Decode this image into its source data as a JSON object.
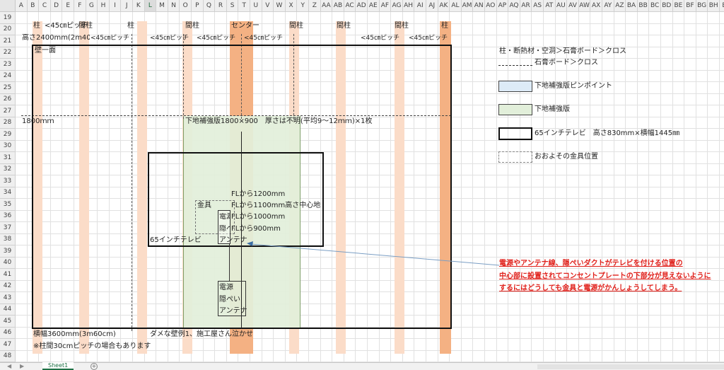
{
  "columns": [
    "A",
    "B",
    "C",
    "D",
    "E",
    "F",
    "G",
    "H",
    "I",
    "J",
    "K",
    "L",
    "M",
    "N",
    "O",
    "P",
    "Q",
    "R",
    "S",
    "T",
    "U",
    "V",
    "W",
    "X",
    "Y",
    "Z",
    "AA",
    "AB",
    "AC",
    "AD",
    "AE",
    "AF",
    "AG",
    "AH",
    "AI",
    "AJ",
    "AK",
    "AL",
    "AM",
    "AN",
    "AO",
    "AP",
    "AQ",
    "AR",
    "AS",
    "AT",
    "AU",
    "AV",
    "AW",
    "AX",
    "AY",
    "AZ",
    "BA",
    "BB",
    "BC",
    "BD",
    "BE",
    "BF",
    "BG",
    "BH",
    "BI"
  ],
  "selected_column": "L",
  "rows": [
    "19",
    "20",
    "21",
    "22",
    "23",
    "24",
    "25",
    "26",
    "27",
    "28",
    "29",
    "30",
    "31",
    "32",
    "33",
    "34",
    "35",
    "36",
    "37",
    "38",
    "39",
    "40",
    "41",
    "42",
    "43",
    "44",
    "45",
    "46",
    "47",
    "48"
  ],
  "colors": {
    "pillar": "#fbdcc8",
    "pillar_dark": "#f4b183",
    "board": "#e2efda",
    "pinpoint": "#ddebf7",
    "arrow": "#7a9ec4",
    "red": "#e0201a"
  },
  "top_labels": {
    "pillar_1": "柱",
    "pitch_1": "<45㎝ピッチ",
    "mabashira_1": "間柱",
    "pillar_2": "柱",
    "mabashira_2": "間柱",
    "center": "センター",
    "mabashira_3": "間柱",
    "mabashira_4": "間柱",
    "mabashira_5": "間柱",
    "pillar_3": "柱"
  },
  "row21": {
    "height": "高さ2400mm(2m40cm)",
    "pitch_a": "<45㎝ピッチ",
    "pitch_b": "<45㎝ピッチ",
    "pitch_c": "<45㎝ピッチ",
    "pitch_d": "<45㎝ピッチ",
    "pitch_e": "<45㎝ピッチ",
    "pitch_f": "<45㎝ピッチ"
  },
  "wall": {
    "label": "壁一面",
    "height_1800": "1800ｍｍ",
    "board_label": "下地補強版1800×900　厚さは不明(平均9～12ｍｍ)×1枚",
    "width_label": "横幅3600mm(3m60cm)",
    "note": "※柱間30cmピッチの場合もあります",
    "bad_example": "ダメな壁例1、施工屋さん泣かせ"
  },
  "tv": {
    "fl1200": "FLから1200mm",
    "fl1100": "FLから1100mm高さ中心地",
    "kanagu": "金具",
    "fl1000": "FLから1000mm",
    "fl900": "FLから900mm",
    "tv_label": "65インチテレビ",
    "power_top": "電源",
    "duct_top": "隠ぺい",
    "antenna_top": "アンテナ",
    "power_bottom": "電源",
    "duct_bottom": "隠ぺい",
    "antenna_bottom": "アンテナ"
  },
  "legend": {
    "pillar_text": "柱・断熱材・空洞＞石膏ボード＞クロス",
    "board_text": "石膏ボード＞クロス",
    "pinpoint": "下地補強版ピンポイント",
    "board": "下地補強版",
    "tv": "65インチテレビ　高さ830mm×横幅1445㎜",
    "mount": "おおよその金具位置"
  },
  "note": {
    "line1": "電源やアンテナ線、隠ぺいダクトがテレビを付ける位置の",
    "line2": "中心部に設置されてコンセントプレートの下部分が見えないように",
    "line3": "するにはどうしても金具と電源がかんしょうしてしまう。"
  },
  "sheet_tab": "Sheet1",
  "add_sheet": "+"
}
